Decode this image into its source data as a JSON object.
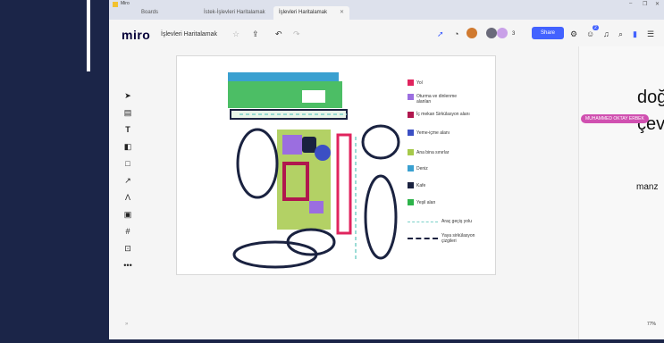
{
  "window": {
    "title": "Miro",
    "controls": [
      "–",
      "❐",
      "✕"
    ]
  },
  "tabs": [
    {
      "label": "Boards",
      "active": false
    },
    {
      "label": "İstek-İşlevleri Haritalamak",
      "active": false
    },
    {
      "label": "İşlevleri Haritalamak",
      "active": true
    }
  ],
  "toolbar": {
    "logo": "miro",
    "board_name": "İşlevleri Haritalamak",
    "collaborator_count": "3",
    "share_label": "Share",
    "notification_badge": "2"
  },
  "legend": [
    {
      "label": "Yol",
      "color": "#e0245e"
    },
    {
      "label": "Oturma ve dinlenme alanları",
      "color": "#9b6ee0"
    },
    {
      "label": "İç mekan Sirkülasyon alanı",
      "color": "#b0174e"
    },
    {
      "label": "Yeme-içme alanı",
      "color": "#3b4fc4"
    },
    {
      "label": "Ana bina sınırlar",
      "color": "#a6c94a"
    },
    {
      "label": "Deniz",
      "color": "#3aa0d0"
    },
    {
      "label": "Kafe",
      "color": "#1a2240"
    },
    {
      "label": "Yeşil alan",
      "color": "#2db34a"
    },
    {
      "label": "Araç geçiş yolu",
      "color": "#7ad0c8"
    },
    {
      "label": "Yaya sirkülasyon çizgileri",
      "color": "#1a2240"
    }
  ],
  "right_panel": {
    "line1": "doğ",
    "line2": "çev",
    "line3": "manz"
  },
  "cursor_tag": "MUHAMMED OKTAY ERBEK",
  "zoom": "77%",
  "colors": {
    "accent": "#4262ff",
    "background": "#1b2548"
  }
}
